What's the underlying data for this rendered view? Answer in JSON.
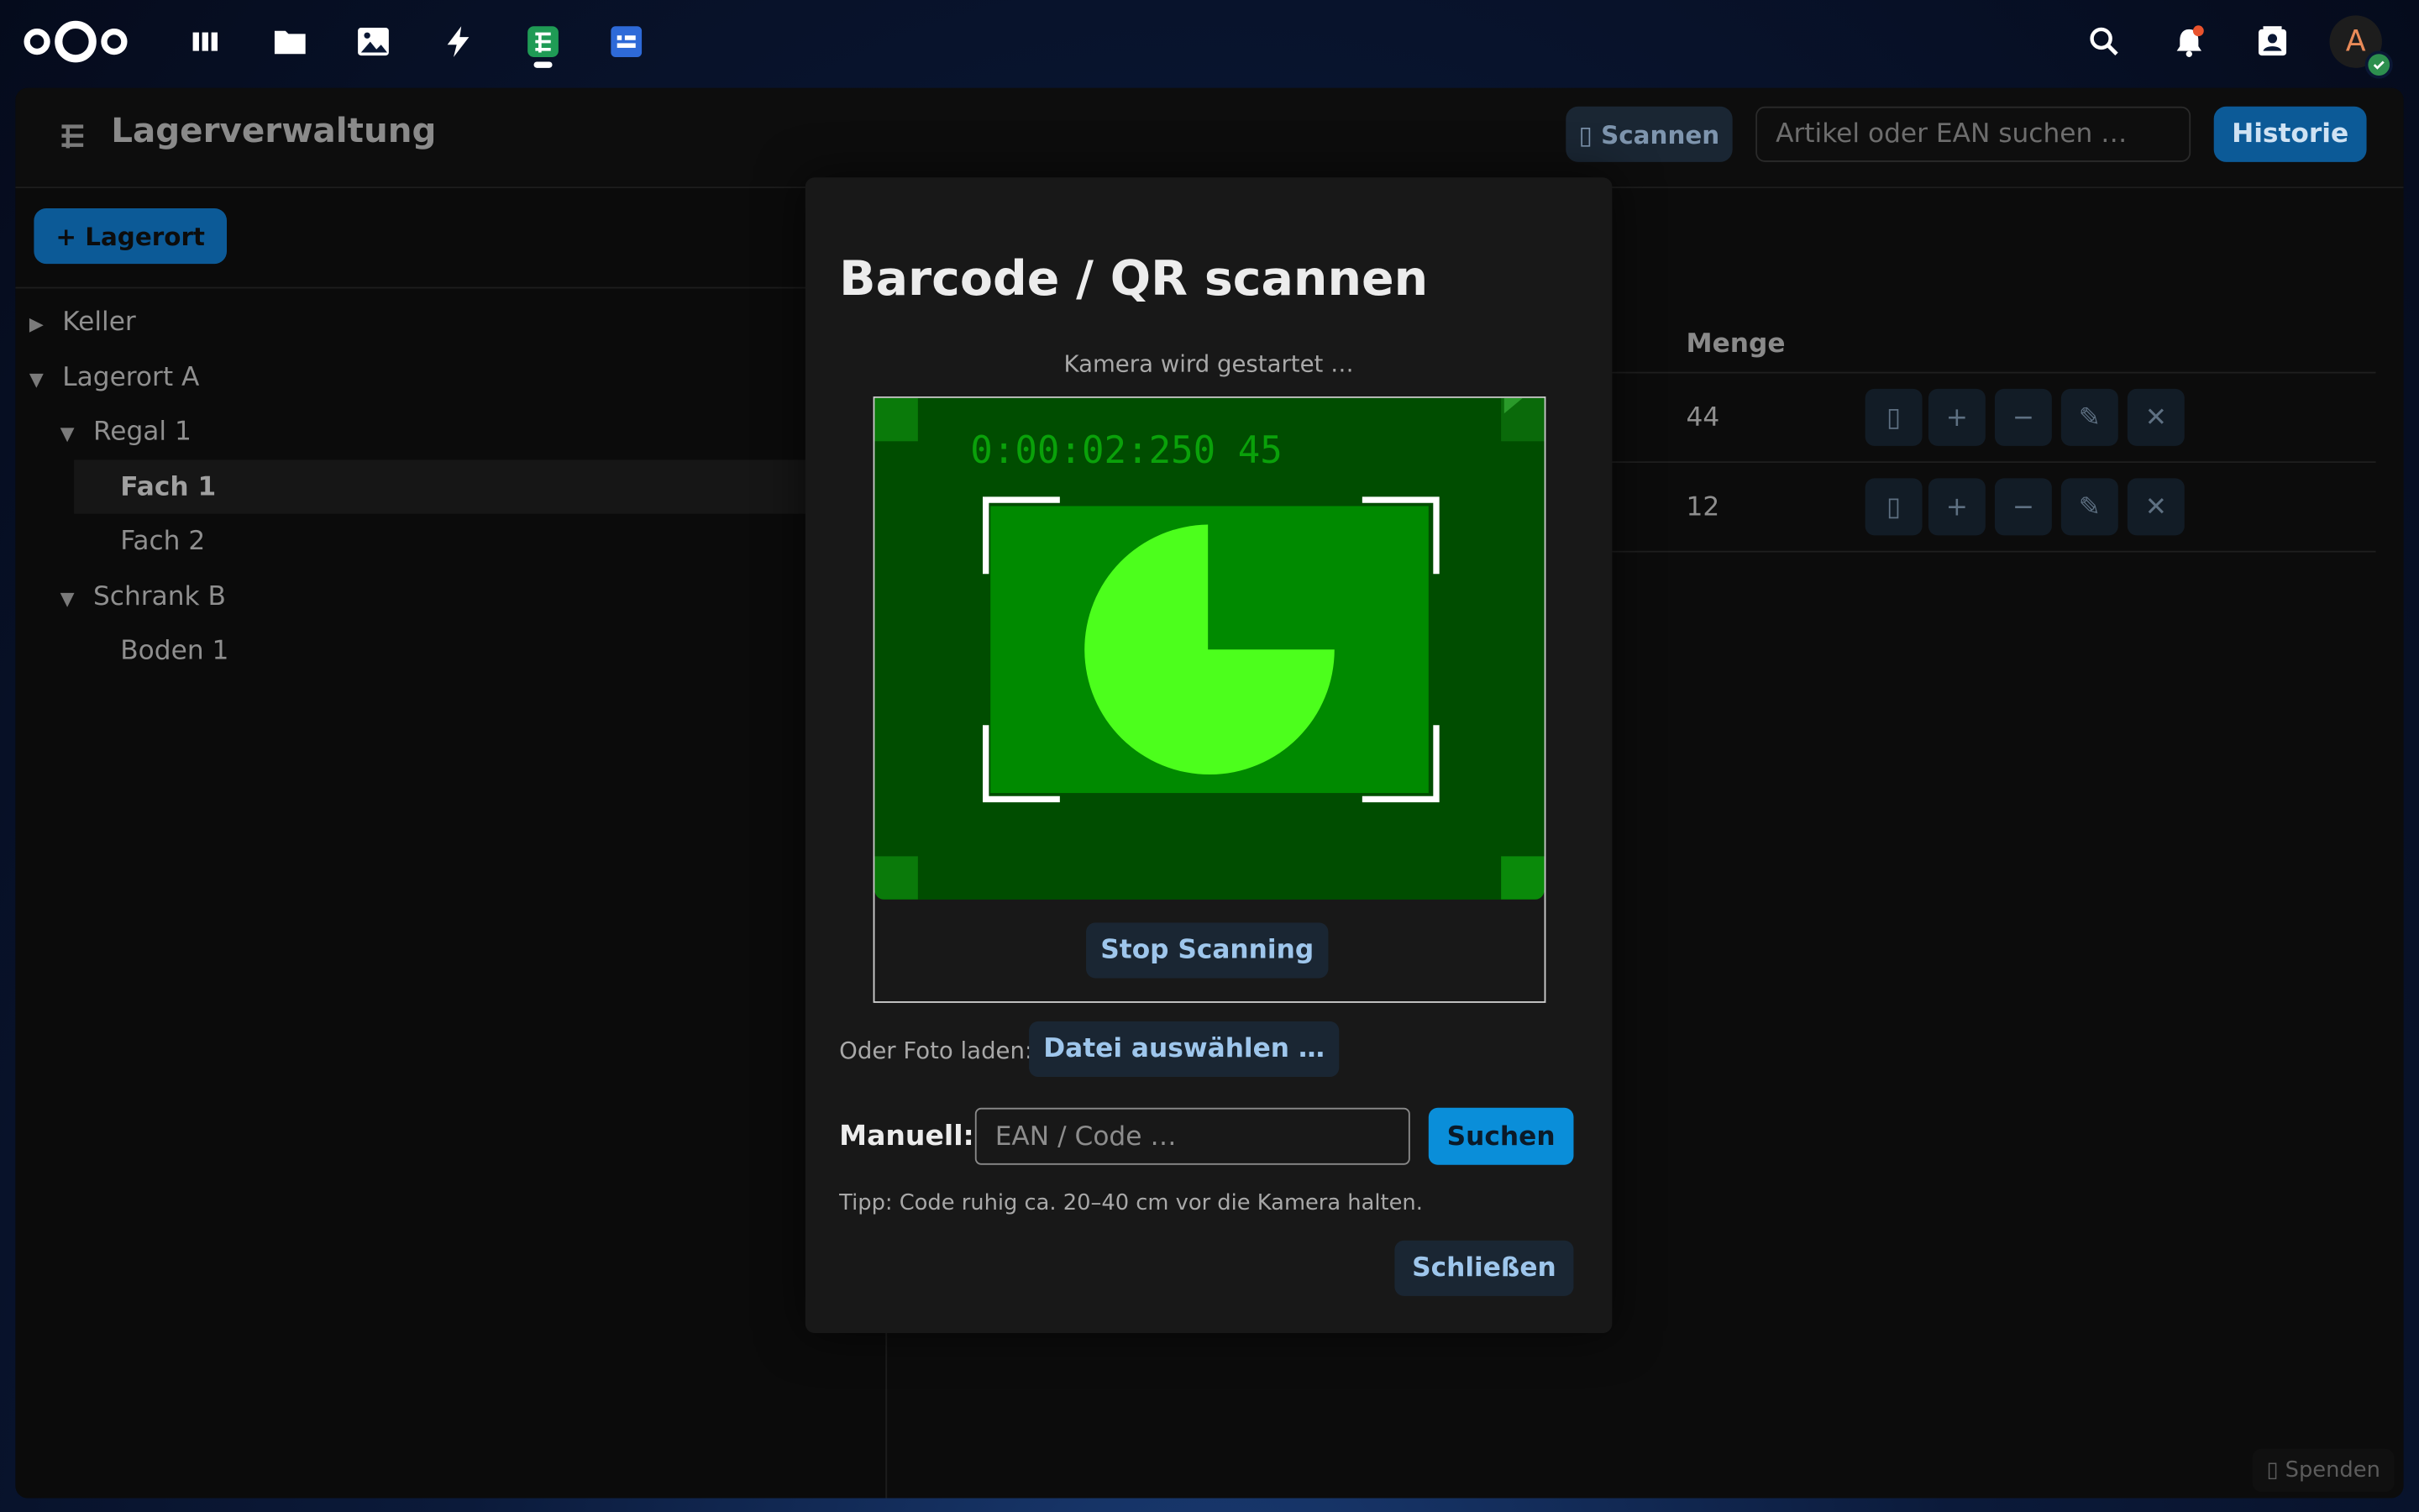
{
  "topbar": {
    "apps": [
      {
        "name": "dashboard-icon"
      },
      {
        "name": "files-icon"
      },
      {
        "name": "photos-icon"
      },
      {
        "name": "activity-icon"
      },
      {
        "name": "inventory-app-icon"
      },
      {
        "name": "forms-icon"
      }
    ],
    "avatar_letter": "A"
  },
  "header": {
    "title": "Lagerverwaltung",
    "scan_label": "▯ Scannen",
    "search_placeholder": "Artikel oder EAN suchen …",
    "history_label": "Historie"
  },
  "sidebar": {
    "add_location_label": "+ Lagerort",
    "tree": [
      {
        "label": "Keller",
        "arrow": "▶"
      },
      {
        "label": "Lagerort A",
        "arrow": "▼"
      },
      {
        "label": "Regal 1",
        "arrow": "▼"
      },
      {
        "label": "Fach 1",
        "arrow": ""
      },
      {
        "label": "Fach 2",
        "arrow": ""
      },
      {
        "label": "Schrank B",
        "arrow": "▼"
      },
      {
        "label": "Boden 1",
        "arrow": ""
      }
    ]
  },
  "table": {
    "quantity_header": "Menge",
    "rows": [
      {
        "quantity": "44"
      },
      {
        "quantity": "12"
      }
    ],
    "actions": [
      "▯",
      "+",
      "−",
      "✎",
      "✕"
    ]
  },
  "donate_label": "▯ Spenden",
  "modal": {
    "title": "Barcode / QR scannen",
    "camera_status": "Kamera wird gestartet …",
    "video_timestamp": "0:00:02:250 45",
    "stop_label": "Stop Scanning",
    "photo_label": "Oder Foto laden:",
    "file_label": "Datei auswählen …",
    "manual_label": "Manuell:",
    "manual_placeholder": "EAN / Code …",
    "search_label": "Suchen",
    "tip": "Tipp: Code ruhig ca. 20–40 cm vor die Kamera halten.",
    "close_label": "Schließen"
  },
  "colors": {
    "primary": "#0c5a97",
    "primary_bright": "#0a8ed9",
    "video_bg": "#004d00",
    "video_card": "#008a00",
    "pie": "#4cff1c"
  }
}
